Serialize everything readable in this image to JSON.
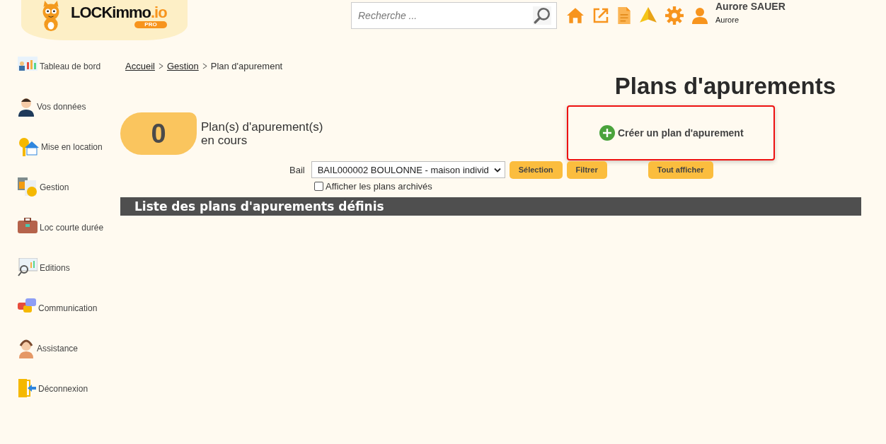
{
  "header": {
    "logo": {
      "name": "LOCKimmo",
      "suffix": ".io",
      "badge": "PRO"
    },
    "search": {
      "placeholder": "Recherche ..."
    },
    "user": {
      "name": "Aurore SAUER",
      "first_name": "Aurore"
    }
  },
  "sidebar": {
    "items": [
      {
        "label": "Tableau de bord",
        "kind": "dashboard"
      },
      {
        "label": "Vos données",
        "kind": "person"
      },
      {
        "label": "Mise en location",
        "kind": "key"
      },
      {
        "label": "Gestion",
        "kind": "calculator"
      },
      {
        "label": "Loc courte durée",
        "kind": "suitcase"
      },
      {
        "label": "Editions",
        "kind": "monitor"
      },
      {
        "label": "Communication",
        "kind": "chat"
      },
      {
        "label": "Assistance",
        "kind": "headset"
      },
      {
        "label": "Déconnexion",
        "kind": "exit"
      }
    ]
  },
  "breadcrumb": {
    "links": [
      "Accueil",
      "Gestion"
    ],
    "current": "Plan d'apurement"
  },
  "title": "Plans d'apurements",
  "counter": {
    "value": "0",
    "label_line1": "Plan(s) d'apurement(s)",
    "label_line2": "en cours"
  },
  "create_button": "Créer un plan d'apurement",
  "filter": {
    "label": "Bail",
    "select_value": "BAIL000002 BOULONNE - maison individ",
    "buttons": [
      "Sélection",
      "Filtrer",
      "Tout afficher"
    ],
    "archived_checkbox": {
      "label": "Afficher les plans archivés",
      "checked": false
    }
  },
  "list_header": "Liste des plans d'apurements définis"
}
